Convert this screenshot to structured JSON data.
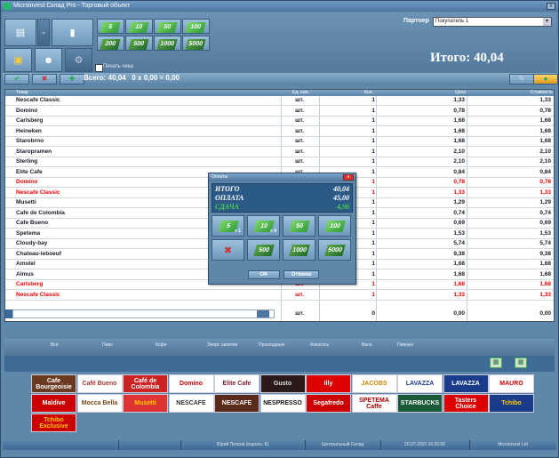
{
  "window": {
    "title": "Microinvest Склад Pro - Торговый объект"
  },
  "toolbar": {
    "money_row1": [
      "5",
      "10",
      "50",
      "100"
    ],
    "money_row2": [
      "200",
      "500",
      "1000",
      "5000"
    ],
    "print_check_label": "Печать чека"
  },
  "partner": {
    "label": "Партнер",
    "value": "Покупатель 1"
  },
  "totals": {
    "big_total": "Итого:  40,04",
    "summary": "Всего: 40,04   0 x 0,00 = 0,00"
  },
  "grid": {
    "columns": [
      "Товар",
      "Ед. изм.",
      "Кол.",
      "Цена",
      "Стоимость"
    ],
    "rows": [
      {
        "name": "Nescafe Classic",
        "unit": "шт.",
        "qty": "1",
        "price": "1,33",
        "sum": "1,33",
        "red": false
      },
      {
        "name": "Domino",
        "unit": "шт.",
        "qty": "1",
        "price": "0,78",
        "sum": "0,78",
        "red": false
      },
      {
        "name": "Carlsberg",
        "unit": "шт.",
        "qty": "1",
        "price": "1,68",
        "sum": "1,68",
        "red": false
      },
      {
        "name": "Heineken",
        "unit": "шт.",
        "qty": "1",
        "price": "1,68",
        "sum": "1,68",
        "red": false
      },
      {
        "name": "Starobrno",
        "unit": "шт.",
        "qty": "1",
        "price": "1,68",
        "sum": "1,68",
        "red": false
      },
      {
        "name": "Staropramen",
        "unit": "шт.",
        "qty": "1",
        "price": "2,10",
        "sum": "2,10",
        "red": false
      },
      {
        "name": "Sterling",
        "unit": "шт.",
        "qty": "1",
        "price": "2,10",
        "sum": "2,10",
        "red": false
      },
      {
        "name": "Elite Cafe",
        "unit": "шт.",
        "qty": "1",
        "price": "0,84",
        "sum": "0,84",
        "red": false
      },
      {
        "name": "Domino",
        "unit": "шт.",
        "qty": "1",
        "price": "0,78",
        "sum": "0,78",
        "red": true
      },
      {
        "name": "Nescafe Classic",
        "unit": "шт.",
        "qty": "1",
        "price": "1,33",
        "sum": "1,33",
        "red": true
      },
      {
        "name": "Musetti",
        "unit": "шт.",
        "qty": "1",
        "price": "1,29",
        "sum": "1,29",
        "red": false
      },
      {
        "name": "Cafe de Colombia",
        "unit": "шт.",
        "qty": "1",
        "price": "0,74",
        "sum": "0,74",
        "red": false
      },
      {
        "name": "Cafe Bueno",
        "unit": "шт.",
        "qty": "1",
        "price": "0,69",
        "sum": "0,69",
        "red": false
      },
      {
        "name": "Spetema",
        "unit": "шт.",
        "qty": "1",
        "price": "1,53",
        "sum": "1,53",
        "red": false
      },
      {
        "name": "Cloudy-bay",
        "unit": "шт.",
        "qty": "1",
        "price": "5,74",
        "sum": "5,74",
        "red": false
      },
      {
        "name": "Chateau-leboeuf",
        "unit": "шт.",
        "qty": "1",
        "price": "9,38",
        "sum": "9,38",
        "red": false
      },
      {
        "name": "Amstel",
        "unit": "шт.",
        "qty": "1",
        "price": "1,68",
        "sum": "1,68",
        "red": false
      },
      {
        "name": "Almus",
        "unit": "шт.",
        "qty": "1",
        "price": "1,68",
        "sum": "1,68",
        "red": false
      },
      {
        "name": "Carlsberg",
        "unit": "шт.",
        "qty": "1",
        "price": "1,68",
        "sum": "1,68",
        "red": true
      },
      {
        "name": "Nescafe Classic",
        "unit": "шт.",
        "qty": "1",
        "price": "1,33",
        "sum": "1,33",
        "red": true
      },
      {
        "name": "",
        "unit": "шт.",
        "qty": "0",
        "price": "0,00",
        "sum": "0,00",
        "red": false
      }
    ]
  },
  "dialog": {
    "title": "Оплаты",
    "total_label": "ИТОГО",
    "total_value": "40,04",
    "paid_label": "ОПЛАТА",
    "paid_value": "45,00",
    "change_label": "СДАЧА",
    "change_value": "4,96",
    "bills_row1": [
      "5",
      "10",
      "50",
      "100"
    ],
    "bills_row2": [
      "500",
      "1000",
      "5000"
    ],
    "sup1": "x 1",
    "sup2": "x 4",
    "ok_label": "OK",
    "cancel_label": "Отмена"
  },
  "categories": [
    "Все",
    "Пиво",
    "Кофе",
    "Энерг. напитки",
    "Прохладные",
    "Алкоголь",
    "Вино",
    "Пивные"
  ],
  "brands": [
    [
      "Cafe Bourgeoisie",
      "Café Bueno",
      "Café de Colombia",
      "Domino",
      "Elite Cafe",
      "Gusto",
      "illy",
      "JACOBS",
      "LAVAZZA",
      "LAVAZZA",
      "MAURO"
    ],
    [
      "Maldive",
      "Mocca Bella",
      "Musetti",
      "NESCAFE",
      "NESCAFE",
      "NESPRESSO",
      "Segafredo",
      "SPETEMA Caffe",
      "STARBUCKS",
      "Tasters Choice",
      "Tchibo"
    ],
    [
      "Tchibo Exclusive"
    ]
  ],
  "status": {
    "user": "Юрий Петров (пароль: 8)",
    "warehouse": "Центральный Склад",
    "datetime": "20.07.2010 16:26:56",
    "company": "Microinvest Ltd"
  }
}
